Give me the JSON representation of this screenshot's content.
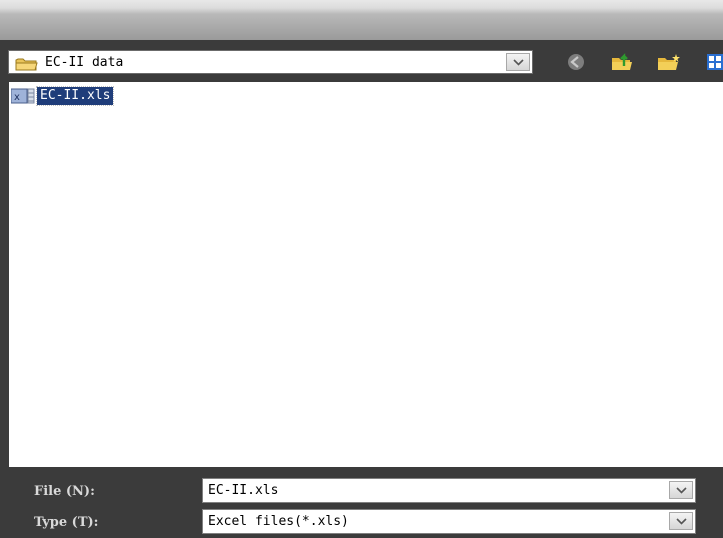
{
  "window": {
    "title": ""
  },
  "look_in": {
    "value": "EC-II data",
    "icon": "folder-icon"
  },
  "toolbar": {
    "icons": [
      "back-icon",
      "up-folder-icon",
      "new-folder-icon",
      "view-menu-icon"
    ]
  },
  "files": [
    {
      "name": "EC-II.xls",
      "icon": "excel-file-icon",
      "selected": true
    }
  ],
  "file_name": {
    "label": "File (N):",
    "value": "EC-II.xls"
  },
  "file_type": {
    "label": "Type (T):",
    "value": "Excel files(*.xls)"
  }
}
